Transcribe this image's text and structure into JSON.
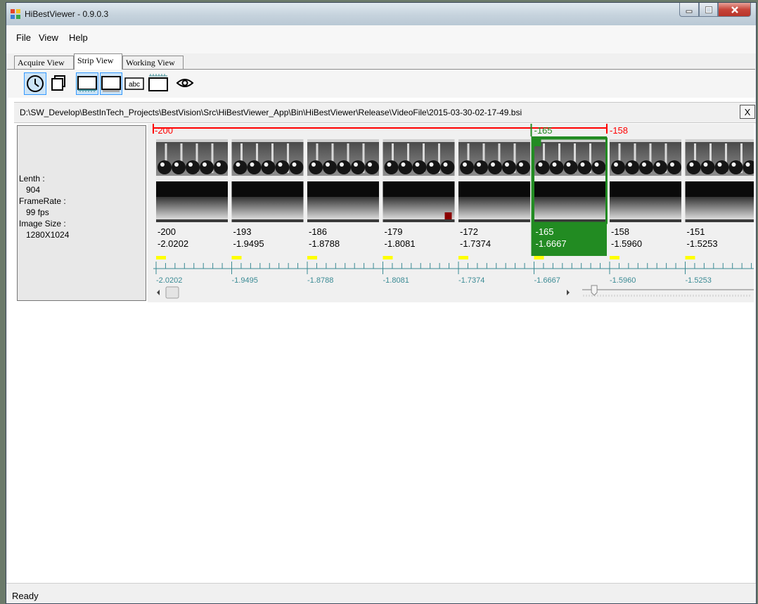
{
  "window": {
    "title": "HiBestViewer - 0.9.0.3",
    "controls": {
      "minimize": "minimize",
      "maximize": "maximize",
      "close": "close"
    }
  },
  "menu": [
    "File",
    "View",
    "Help"
  ],
  "tabs": [
    {
      "label": "Acquire View",
      "active": false
    },
    {
      "label": "Strip View",
      "active": true
    },
    {
      "label": "Working View",
      "active": false
    }
  ],
  "toolbar": {
    "icons": [
      "clock-icon",
      "copy-frame-icon",
      "strip-bottom-ruler-icon",
      "strip-single-icon",
      "text-label-icon",
      "strip-top-ruler-icon",
      "eye-icon"
    ]
  },
  "file": {
    "path": "D:\\SW_Develop\\BestInTech_Projects\\BestVision\\Src\\HiBestViewer_App\\Bin\\HiBestViewer\\Release\\VideoFile\\2015-03-30-02-17-49.bsi",
    "close_label": "X"
  },
  "info": {
    "length_label": "Lenth :",
    "length_value": "904",
    "framerate_label": "FrameRate :",
    "framerate_value": "99 fps",
    "imagesize_label": "Image Size :",
    "imagesize_value": "1280X1024"
  },
  "strip": {
    "range_start": "-200",
    "range_current": "-165",
    "range_end": "-158",
    "selected_index": 5,
    "marker_index": 3,
    "frames": [
      {
        "frame": "-200",
        "time": "-2.0202"
      },
      {
        "frame": "-193",
        "time": "-1.9495"
      },
      {
        "frame": "-186",
        "time": "-1.8788"
      },
      {
        "frame": "-179",
        "time": "-1.8081"
      },
      {
        "frame": "-172",
        "time": "-1.7374"
      },
      {
        "frame": "-165",
        "time": "-1.6667"
      },
      {
        "frame": "-158",
        "time": "-1.5960"
      },
      {
        "frame": "-151",
        "time": "-1.5253"
      }
    ],
    "scroll_position": 0.0,
    "zoom_slider": 0.07
  },
  "status": {
    "text": "Ready"
  },
  "colors": {
    "range_red": "#ff0000",
    "selection_green": "#228b22",
    "marker_red": "#8b0000",
    "ruler_teal": "#3a8a94",
    "tick_yellow": "#ffff00"
  }
}
